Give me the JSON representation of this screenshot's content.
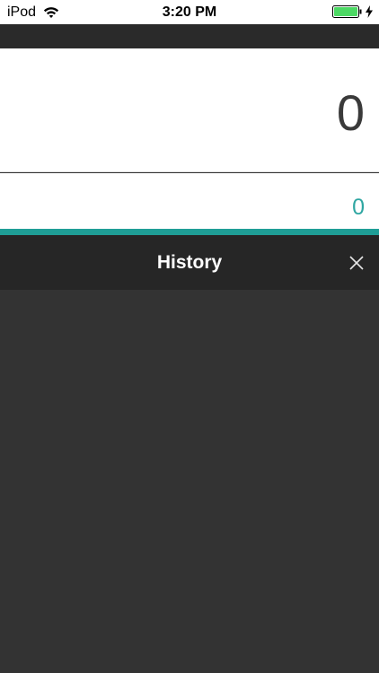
{
  "status_bar": {
    "carrier": "iPod",
    "time": "3:20 PM",
    "icons": [
      "wifi-icon",
      "battery-icon",
      "charging-icon"
    ],
    "battery_color": "#4cd964"
  },
  "display": {
    "main_value": "0",
    "secondary_value": "0"
  },
  "history": {
    "title": "History",
    "close_icon": "close-icon",
    "entries": []
  },
  "colors": {
    "accent": "#1f9e96",
    "secondary_text": "#2fa6a2",
    "header_bg": "#262626",
    "panel_bg": "#333333"
  }
}
